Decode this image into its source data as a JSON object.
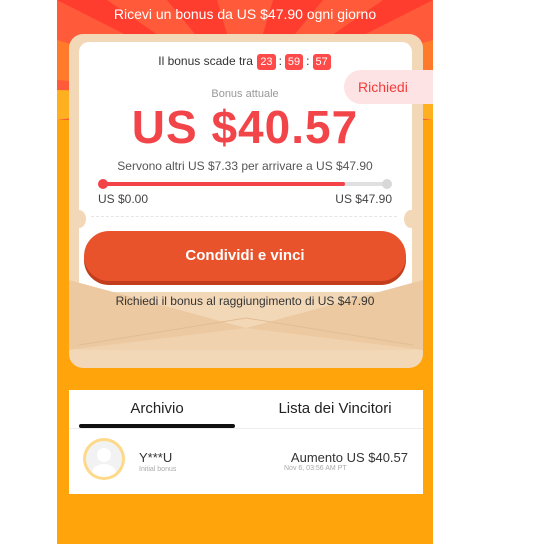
{
  "banner": {
    "text": "Ricevi un bonus da US $47.90 ogni giorno"
  },
  "timer": {
    "label": "Il bonus scade tra",
    "hours": "23",
    "minutes": "59",
    "seconds": "57",
    "separator": ":"
  },
  "claim_button": {
    "label": "Richiedi"
  },
  "bonus": {
    "label": "Bonus attuale",
    "amount": "US $40.57",
    "remaining_text": "Servono altri US $7.33 per arrivare a US $47.90",
    "progress": 0.847,
    "range_min": "US $0.00",
    "range_max": "US $47.90"
  },
  "share_button": {
    "label": "Condividi e vinci"
  },
  "note": "Richiedi il bonus al raggiungimento di US $47.90",
  "tabs": [
    {
      "label": "Archivio",
      "active": true
    },
    {
      "label": "Lista dei Vincitori",
      "active": false
    }
  ],
  "history": [
    {
      "user": "Y***U",
      "subtitle": "Initial bonus",
      "increase": "Aumento US $40.57",
      "date": "Nov 6, 03:56 AM PT"
    }
  ],
  "colors": {
    "background": "#ffa40a",
    "accent": "#f2454a",
    "share_button": "#e8532c",
    "card_border": "#f3d8b8"
  }
}
